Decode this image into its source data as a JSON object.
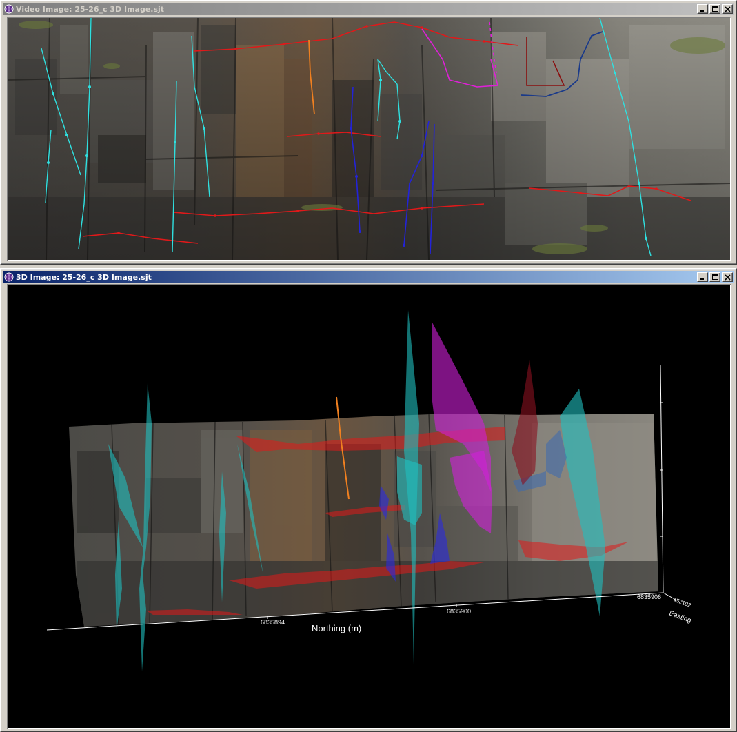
{
  "video_window": {
    "title": "Video Image: 25-26_c 3D Image.sjt"
  },
  "three_d_window": {
    "title": "3D Image: 25-26_c 3D Image.sjt",
    "axes": {
      "northing_label": "Northing (m)",
      "northing_ticks": [
        "6835894",
        "6835900",
        "6835906"
      ],
      "easting_label": "Easting",
      "easting_tick": "452192"
    }
  },
  "colors": {
    "active_title": "#0a246a",
    "inactive_title": "#808080",
    "bedding_trace": "#e0191a",
    "joint_set_cyan": "#2fe0e0",
    "joint_set_blue": "#2323d8",
    "joint_set_magenta": "#e020d8",
    "joint_set_orange": "#f08020",
    "joint_set_navy": "#1a3a8a",
    "joint_set_darkred": "#8a1010"
  },
  "icons": {
    "app_icon": "app-globe-icon",
    "minimize": "minimize-icon",
    "maximize": "maximize-icon",
    "close": "close-icon"
  }
}
